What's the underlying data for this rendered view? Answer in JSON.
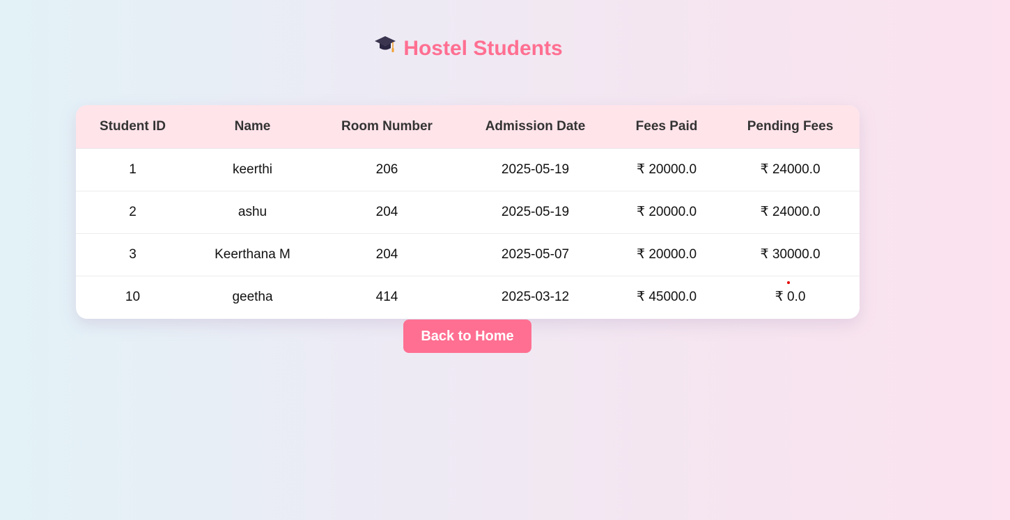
{
  "header": {
    "title": "Hostel Students",
    "icon": "graduation-cap-icon"
  },
  "table": {
    "columns": [
      "Student ID",
      "Name",
      "Room Number",
      "Admission Date",
      "Fees Paid",
      "Pending Fees"
    ],
    "rows": [
      [
        "1",
        "keerthi",
        "206",
        "2025-05-19",
        "₹ 20000.0",
        "₹ 24000.0"
      ],
      [
        "2",
        "ashu",
        "204",
        "2025-05-19",
        "₹ 20000.0",
        "₹ 24000.0"
      ],
      [
        "3",
        "Keerthana M",
        "204",
        "2025-05-07",
        "₹ 20000.0",
        "₹ 30000.0"
      ],
      [
        "10",
        "geetha",
        "414",
        "2025-03-12",
        "₹ 45000.0",
        "₹ 0.0"
      ]
    ]
  },
  "actions": {
    "back_label": "Back to Home"
  },
  "colors": {
    "accent": "#ff6f91",
    "header_row": "#ffe4ea"
  }
}
